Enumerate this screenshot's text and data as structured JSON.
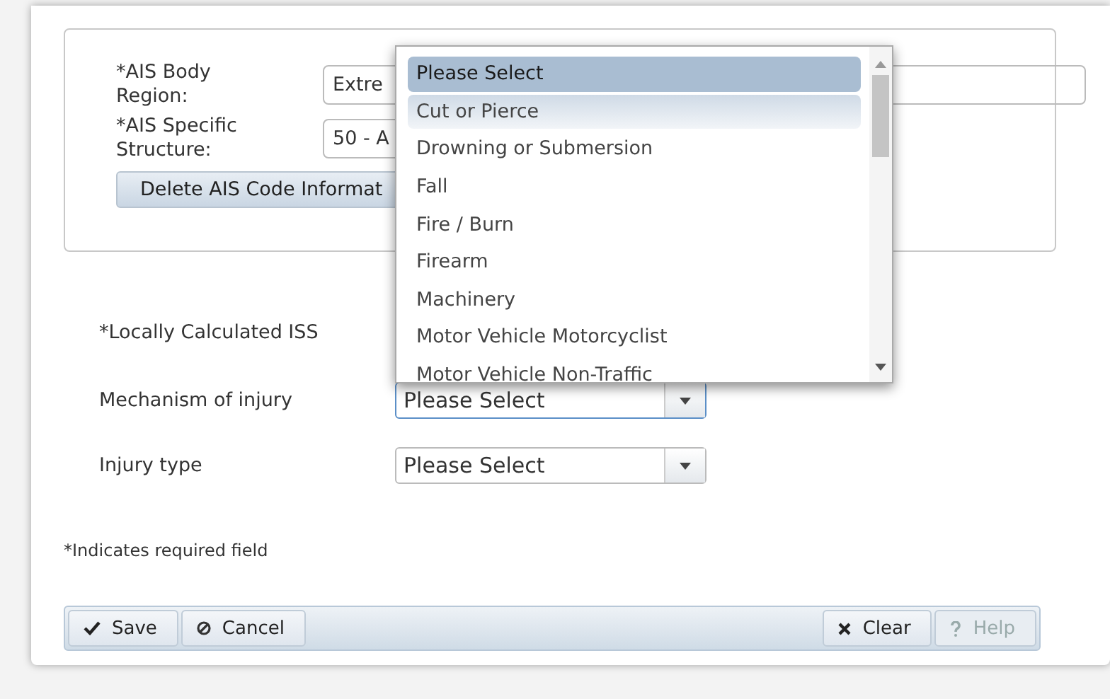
{
  "ais_section": {
    "fields": [
      {
        "label": "*AIS Body Region:",
        "value": "Extre"
      },
      {
        "label": "*AIS Specific Structure:",
        "value": "50 - A"
      }
    ],
    "delete_button": "Delete AIS Code Informat"
  },
  "fields": [
    {
      "label": "*Locally Calculated ISS",
      "kind": "text"
    },
    {
      "label": "Mechanism of injury",
      "kind": "select",
      "value": "Please Select",
      "focused": true
    },
    {
      "label": "Injury type",
      "kind": "select",
      "value": "Please Select",
      "focused": false
    }
  ],
  "dropdown": {
    "options": [
      {
        "label": "Please Select",
        "selected": true,
        "hovered": false
      },
      {
        "label": "Cut or Pierce",
        "selected": false,
        "hovered": true
      },
      {
        "label": "Drowning or Submersion",
        "selected": false,
        "hovered": false
      },
      {
        "label": "Fall",
        "selected": false,
        "hovered": false
      },
      {
        "label": "Fire / Burn",
        "selected": false,
        "hovered": false
      },
      {
        "label": "Firearm",
        "selected": false,
        "hovered": false
      },
      {
        "label": "Machinery",
        "selected": false,
        "hovered": false
      },
      {
        "label": "Motor Vehicle Motorcyclist",
        "selected": false,
        "hovered": false
      },
      {
        "label": "Motor Vehicle Non-Traffic",
        "selected": false,
        "hovered": false
      }
    ]
  },
  "required_note": "*Indicates required field",
  "toolbar": {
    "left": [
      {
        "label": "Save",
        "kind": "save",
        "disabled": false
      },
      {
        "label": "Cancel",
        "kind": "cancel",
        "disabled": false
      }
    ],
    "right": [
      {
        "label": "Clear",
        "kind": "clear",
        "disabled": false
      },
      {
        "label": "Help",
        "kind": "help",
        "disabled": true
      }
    ]
  }
}
